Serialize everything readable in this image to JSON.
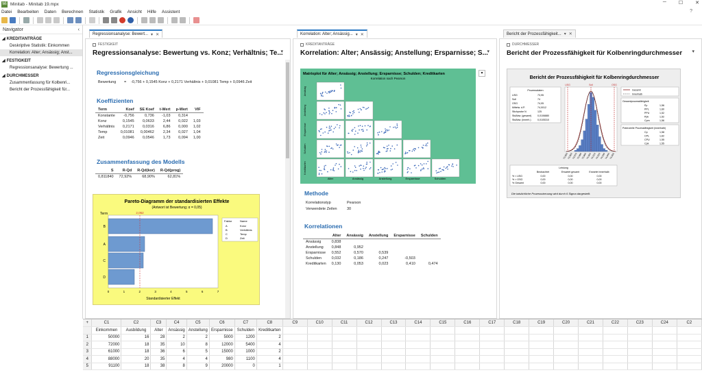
{
  "window": {
    "title": "Minitab - Minitab 19.mpx",
    "app_icon": "Mi"
  },
  "menu": [
    "Datei",
    "Bearbeiten",
    "Daten",
    "Berechnen",
    "Statistik",
    "Grafik",
    "Ansicht",
    "Hilfe",
    "Assistent"
  ],
  "navigator": {
    "title": "Navigator",
    "groups": [
      {
        "name": "KREDITANTRÄGE",
        "items": [
          "Deskriptive Statistik: Einkommen",
          "Korrelation: Alter; Ansässig; Anst..."
        ],
        "selected": 1
      },
      {
        "name": "FESTIGKEIT",
        "items": [
          "Regressionsanalyse: Bewertung ..."
        ],
        "selected": -1
      },
      {
        "name": "DURCHMESSER",
        "items": [
          "Zusammenfassung für Kolbenri...",
          "Bericht der Prozessfähigkeit für..."
        ],
        "selected": -1
      }
    ]
  },
  "tabs": [
    {
      "label": "Regressionsanalyse: Bewert...",
      "active": true
    },
    {
      "label": "Korrelation: Alter; Ansässig...",
      "active": true
    },
    {
      "label": "Bericht der Prozessfähigkeit...",
      "active": false
    }
  ],
  "panel1": {
    "group": "FESTIGKEIT",
    "title": "Regressionsanalyse: Bewertung vs. Konz; Verhältnis; Te...",
    "eq_heading": "Regressionsgleichung",
    "eq_lhs": "Bewertung",
    "eq_eq": "=",
    "eq_rhs": "-0,756 + 0,1545 Konz + 0,2171 Verhältnis + 0,01081 Temp + 0,0946 Zeit",
    "coef_heading": "Koeffizienten",
    "coef_headers": [
      "Term",
      "Koef",
      "SE Koef",
      "t-Wert",
      "p-Wert",
      "VIF"
    ],
    "coef_rows": [
      [
        "Konstante",
        "-0,756",
        "0,736",
        "-1,03",
        "0,314",
        ""
      ],
      [
        "Konz",
        "0,1545",
        "0,0633",
        "2,44",
        "0,022",
        "1,03"
      ],
      [
        "Verhältnis",
        "0,2171",
        "0,0316",
        "6,86",
        "0,000",
        "1,02"
      ],
      [
        "Temp",
        "0,01081",
        "0,00462",
        "2,34",
        "0,027",
        "1,04"
      ],
      [
        "Zeit",
        "0,0946",
        "0,0546",
        "1,73",
        "0,094",
        "1,00"
      ]
    ],
    "summary_heading": "Zusammenfassung des Modells",
    "summary_headers": [
      "S",
      "R-Qd",
      "R-Qd(kor)",
      "R-Qd(prog)"
    ],
    "summary_values": [
      "0,811840",
      "72,92%",
      "68,90%",
      "62,81%"
    ],
    "pareto": {
      "title": "Pareto-Diagramm der standardisierten Effekte",
      "subtitle": "(Antwort ist Bewertung; α = 0,05)",
      "xlabel": "Standardisierter Effekt",
      "ylabel": "Term",
      "reference": "2,052",
      "legend_header": [
        "Faktor",
        "Name"
      ],
      "legend_rows": [
        [
          "A",
          "Konz"
        ],
        [
          "B",
          "Verhältnis"
        ],
        [
          "C",
          "Temp"
        ],
        [
          "D",
          "Zeit"
        ]
      ]
    }
  },
  "panel2": {
    "group": "KREDITANTRÄGE",
    "title": "Korrelation: Alter; Ansässig; Anstellung; Ersparnisse; S...",
    "matrix_title": "Matrixplot für Alter; Ansässig; Anstellung; Ersparnisse; Schulden; Kreditkarten",
    "matrix_subtitle": "Korrelation nach Pearson",
    "matrix_vars": [
      "Alter",
      "Ansässig",
      "Anstellung",
      "Ersparnisse",
      "Schulden",
      "Kreditkarten"
    ],
    "method_heading": "Methode",
    "method_rows": [
      [
        "Korrelationstyp",
        "Pearson"
      ],
      [
        "Verwendete Zeilen",
        "30"
      ]
    ],
    "corr_heading": "Korrelationen",
    "corr_headers": [
      "",
      "Alter",
      "Ansässig",
      "Anstellung",
      "Ersparnisse",
      "Schulden"
    ],
    "corr_rows": [
      [
        "Ansässig",
        "0,838",
        "",
        "",
        "",
        ""
      ],
      [
        "Anstellung",
        "0,848",
        "0,952",
        "",
        "",
        ""
      ],
      [
        "Ersparnisse",
        "0,552",
        "0,570",
        "0,539",
        "",
        ""
      ],
      [
        "Schulden",
        "0,032",
        "0,186",
        "0,247",
        "-0,503",
        ""
      ],
      [
        "Kreditkarten",
        "0,130",
        "0,053",
        "0,023",
        "0,410",
        "0,474"
      ]
    ]
  },
  "panel3": {
    "group": "DURCHMESSER",
    "title": "Bericht der Prozessfähigkeit für Kolbenringdurchmesser",
    "fig_title": "Bericht der Prozessfähigkeit für Kolbenringdurchmesser",
    "proc_heading": "Prozessdaten",
    "proc_rows": [
      [
        "USG",
        "73,95"
      ],
      [
        "Soll",
        "74"
      ],
      [
        "OSG",
        "74,05"
      ],
      [
        "Mittelw. d.P.",
        "74,0012"
      ],
      [
        "Stichprobe N",
        "125"
      ],
      [
        "StdAbw. (gesamt)",
        "0,0106880"
      ],
      [
        "StdAbw. (innerh.)",
        "0,0105310"
      ]
    ],
    "legend": [
      "Gesamt",
      "Innerhalb"
    ],
    "overall_heading": "Gesamtprozessfähigkeit",
    "overall_rows": [
      [
        "Pp",
        "1,56"
      ],
      [
        "PPL",
        "1,60"
      ],
      [
        "PPU",
        "1,52"
      ],
      [
        "Ppk",
        "1,52"
      ],
      [
        "Cpm",
        "1,56"
      ]
    ],
    "within_heading": "Potenzielle Prozessfähigkeit (innerhalb)",
    "within_rows": [
      [
        "Cp",
        "1,58"
      ],
      [
        "CPL",
        "1,62"
      ],
      [
        "CPU",
        "1,55"
      ],
      [
        "Cpk",
        "1,55"
      ]
    ],
    "perf_heading": "Leistung",
    "perf_headers": [
      "",
      "Beobachtet",
      "Erwartet gesamt",
      "Erwartet innerhalb"
    ],
    "perf_rows": [
      [
        "% < USG",
        "0,00",
        "0,00",
        "0,00"
      ],
      [
        "% > OSG",
        "0,00",
        "0,00",
        "0,00"
      ],
      [
        "% Gesamt",
        "0,00",
        "0,00",
        "0,00"
      ]
    ],
    "footnote": "Die tatsächliche Prozessstreuung wird durch 6 Sigma dargestellt.",
    "x_ticks": [
      "73,950",
      "73,960",
      "73,970",
      "73,980",
      "73,990",
      "74,000",
      "74,010",
      "74,020",
      "74,030",
      "74,040",
      "74,050"
    ],
    "spec_labels": [
      "USG",
      "Soll",
      "OSG"
    ]
  },
  "worksheet": {
    "col_ids": [
      "C1",
      "C2",
      "C3",
      "C4",
      "C5",
      "C6",
      "C7",
      "C8",
      "C9",
      "C10",
      "C11",
      "C12",
      "C13",
      "C14",
      "C15",
      "C16",
      "C17",
      "C18",
      "C19",
      "C20",
      "C21",
      "C22",
      "C23",
      "C24",
      "C2"
    ],
    "col_names": [
      "Einkommen",
      "Ausbildung",
      "Alter",
      "Ansässig",
      "Anstellung",
      "Ersparnisse",
      "Schulden",
      "Kreditkarten"
    ],
    "rows": [
      [
        "50000",
        "16",
        "28",
        "2",
        "2",
        "5000",
        "1200",
        "2"
      ],
      [
        "72000",
        "18",
        "35",
        "10",
        "8",
        "12000",
        "5400",
        "4"
      ],
      [
        "61000",
        "18",
        "36",
        "6",
        "5",
        "15000",
        "1000",
        "2"
      ],
      [
        "88000",
        "20",
        "35",
        "4",
        "4",
        "980",
        "1100",
        "4"
      ],
      [
        "91100",
        "18",
        "38",
        "8",
        "9",
        "20000",
        "0",
        "1"
      ]
    ]
  }
}
